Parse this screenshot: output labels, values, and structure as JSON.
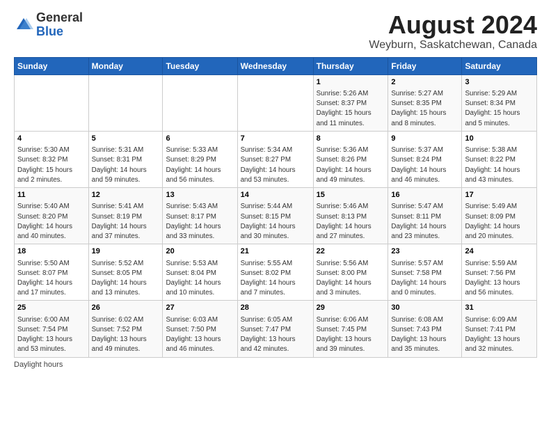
{
  "logo": {
    "general": "General",
    "blue": "Blue"
  },
  "title": "August 2024",
  "subtitle": "Weyburn, Saskatchewan, Canada",
  "days_of_week": [
    "Sunday",
    "Monday",
    "Tuesday",
    "Wednesday",
    "Thursday",
    "Friday",
    "Saturday"
  ],
  "weeks": [
    [
      {
        "day": "",
        "info": ""
      },
      {
        "day": "",
        "info": ""
      },
      {
        "day": "",
        "info": ""
      },
      {
        "day": "",
        "info": ""
      },
      {
        "day": "1",
        "info": "Sunrise: 5:26 AM\nSunset: 8:37 PM\nDaylight: 15 hours\nand 11 minutes."
      },
      {
        "day": "2",
        "info": "Sunrise: 5:27 AM\nSunset: 8:35 PM\nDaylight: 15 hours\nand 8 minutes."
      },
      {
        "day": "3",
        "info": "Sunrise: 5:29 AM\nSunset: 8:34 PM\nDaylight: 15 hours\nand 5 minutes."
      }
    ],
    [
      {
        "day": "4",
        "info": "Sunrise: 5:30 AM\nSunset: 8:32 PM\nDaylight: 15 hours\nand 2 minutes."
      },
      {
        "day": "5",
        "info": "Sunrise: 5:31 AM\nSunset: 8:31 PM\nDaylight: 14 hours\nand 59 minutes."
      },
      {
        "day": "6",
        "info": "Sunrise: 5:33 AM\nSunset: 8:29 PM\nDaylight: 14 hours\nand 56 minutes."
      },
      {
        "day": "7",
        "info": "Sunrise: 5:34 AM\nSunset: 8:27 PM\nDaylight: 14 hours\nand 53 minutes."
      },
      {
        "day": "8",
        "info": "Sunrise: 5:36 AM\nSunset: 8:26 PM\nDaylight: 14 hours\nand 49 minutes."
      },
      {
        "day": "9",
        "info": "Sunrise: 5:37 AM\nSunset: 8:24 PM\nDaylight: 14 hours\nand 46 minutes."
      },
      {
        "day": "10",
        "info": "Sunrise: 5:38 AM\nSunset: 8:22 PM\nDaylight: 14 hours\nand 43 minutes."
      }
    ],
    [
      {
        "day": "11",
        "info": "Sunrise: 5:40 AM\nSunset: 8:20 PM\nDaylight: 14 hours\nand 40 minutes."
      },
      {
        "day": "12",
        "info": "Sunrise: 5:41 AM\nSunset: 8:19 PM\nDaylight: 14 hours\nand 37 minutes."
      },
      {
        "day": "13",
        "info": "Sunrise: 5:43 AM\nSunset: 8:17 PM\nDaylight: 14 hours\nand 33 minutes."
      },
      {
        "day": "14",
        "info": "Sunrise: 5:44 AM\nSunset: 8:15 PM\nDaylight: 14 hours\nand 30 minutes."
      },
      {
        "day": "15",
        "info": "Sunrise: 5:46 AM\nSunset: 8:13 PM\nDaylight: 14 hours\nand 27 minutes."
      },
      {
        "day": "16",
        "info": "Sunrise: 5:47 AM\nSunset: 8:11 PM\nDaylight: 14 hours\nand 23 minutes."
      },
      {
        "day": "17",
        "info": "Sunrise: 5:49 AM\nSunset: 8:09 PM\nDaylight: 14 hours\nand 20 minutes."
      }
    ],
    [
      {
        "day": "18",
        "info": "Sunrise: 5:50 AM\nSunset: 8:07 PM\nDaylight: 14 hours\nand 17 minutes."
      },
      {
        "day": "19",
        "info": "Sunrise: 5:52 AM\nSunset: 8:05 PM\nDaylight: 14 hours\nand 13 minutes."
      },
      {
        "day": "20",
        "info": "Sunrise: 5:53 AM\nSunset: 8:04 PM\nDaylight: 14 hours\nand 10 minutes."
      },
      {
        "day": "21",
        "info": "Sunrise: 5:55 AM\nSunset: 8:02 PM\nDaylight: 14 hours\nand 7 minutes."
      },
      {
        "day": "22",
        "info": "Sunrise: 5:56 AM\nSunset: 8:00 PM\nDaylight: 14 hours\nand 3 minutes."
      },
      {
        "day": "23",
        "info": "Sunrise: 5:57 AM\nSunset: 7:58 PM\nDaylight: 14 hours\nand 0 minutes."
      },
      {
        "day": "24",
        "info": "Sunrise: 5:59 AM\nSunset: 7:56 PM\nDaylight: 13 hours\nand 56 minutes."
      }
    ],
    [
      {
        "day": "25",
        "info": "Sunrise: 6:00 AM\nSunset: 7:54 PM\nDaylight: 13 hours\nand 53 minutes."
      },
      {
        "day": "26",
        "info": "Sunrise: 6:02 AM\nSunset: 7:52 PM\nDaylight: 13 hours\nand 49 minutes."
      },
      {
        "day": "27",
        "info": "Sunrise: 6:03 AM\nSunset: 7:50 PM\nDaylight: 13 hours\nand 46 minutes."
      },
      {
        "day": "28",
        "info": "Sunrise: 6:05 AM\nSunset: 7:47 PM\nDaylight: 13 hours\nand 42 minutes."
      },
      {
        "day": "29",
        "info": "Sunrise: 6:06 AM\nSunset: 7:45 PM\nDaylight: 13 hours\nand 39 minutes."
      },
      {
        "day": "30",
        "info": "Sunrise: 6:08 AM\nSunset: 7:43 PM\nDaylight: 13 hours\nand 35 minutes."
      },
      {
        "day": "31",
        "info": "Sunrise: 6:09 AM\nSunset: 7:41 PM\nDaylight: 13 hours\nand 32 minutes."
      }
    ]
  ],
  "footer": "Daylight hours"
}
